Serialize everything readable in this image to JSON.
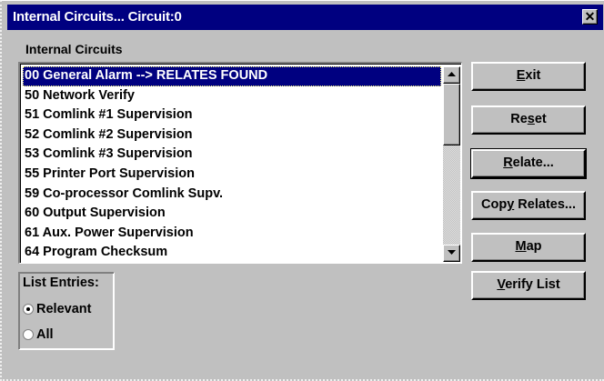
{
  "window": {
    "title": "Internal Circuits... Circuit:0",
    "close_glyph": "✕"
  },
  "group": {
    "label": "Internal Circuits"
  },
  "list": {
    "items": [
      "00 General Alarm --> RELATES FOUND",
      "50 Network Verify",
      "51 Comlink #1 Supervision",
      "52 Comlink #2 Supervision",
      "53 Comlink #3 Supervision",
      "55 Printer Port Supervision",
      "59 Co-processor Comlink Supv.",
      "60 Output Supervision",
      "61 Aux. Power Supervision",
      "64 Program Checksum"
    ],
    "selected_index": 0,
    "scrollbar_position": 0
  },
  "buttons": {
    "exit": {
      "pre": "",
      "accel": "E",
      "post": "xit"
    },
    "reset": {
      "pre": "Re",
      "accel": "s",
      "post": "et"
    },
    "relate": {
      "pre": "",
      "accel": "R",
      "post": "elate..."
    },
    "copy_relates": {
      "pre": "Cop",
      "accel": "y",
      "post": " Relates..."
    },
    "map": {
      "pre": "",
      "accel": "M",
      "post": "ap"
    },
    "verify_list": {
      "pre": "",
      "accel": "V",
      "post": "erify List"
    }
  },
  "list_entries": {
    "label": "List Entries:",
    "options": [
      "Relevant",
      "All"
    ],
    "selected": "Relevant"
  },
  "colors": {
    "titlebar": "#000080",
    "face": "#c0c0c0",
    "selection": "#000080"
  },
  "icons": {
    "close": "close-icon",
    "scroll_up": "scroll-up-arrow-icon",
    "scroll_down": "scroll-down-arrow-icon"
  }
}
